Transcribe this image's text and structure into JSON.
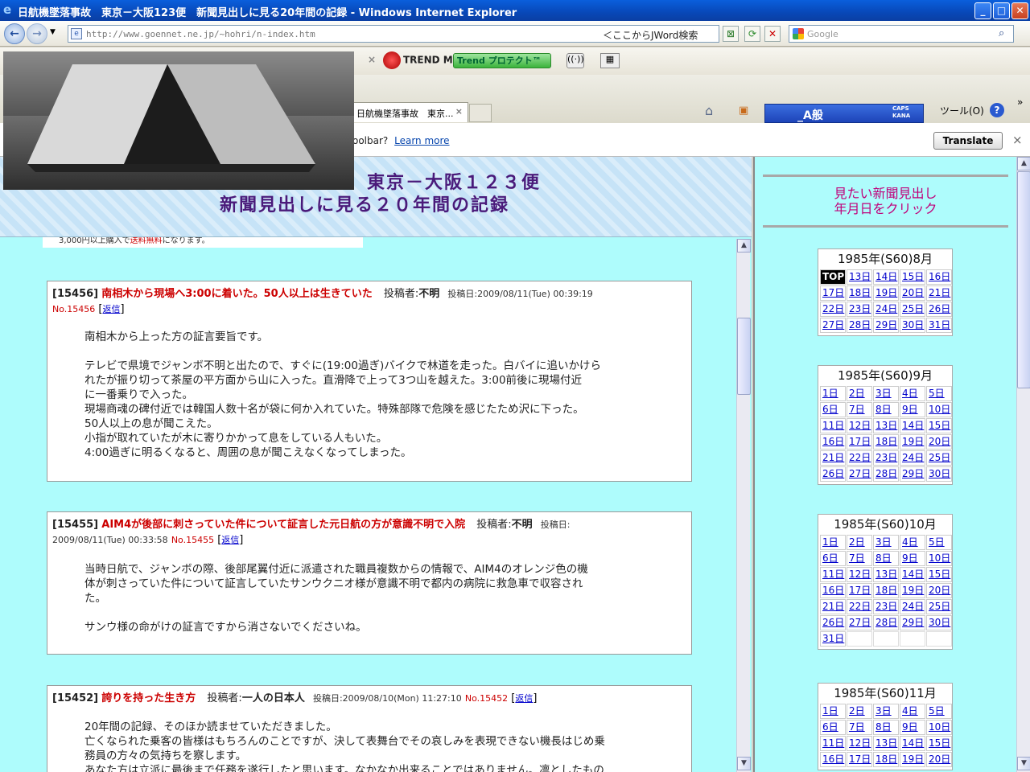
{
  "window": {
    "title": "日航機墜落事故　東京－大阪123便　新聞見出しに見る20年間の記録 - Windows Internet Explorer",
    "minimize_glyph": "_",
    "maximize_glyph": "□",
    "close_glyph": "✕"
  },
  "address_bar": {
    "url": "http://www.goennet.ne.jp/~hohri/n-index.htm",
    "jword_label": "＜ここからJWord検索",
    "search_placeholder": "Google"
  },
  "toolbar": {
    "trend_label": "TREND MICRO",
    "protect_label": "Trend プロテクト™",
    "tools_label": "ツール(O)",
    "caps_label": "CAPS KANA",
    "ime_label": "_A般"
  },
  "tab": {
    "label": "日航機墜落事故　東京...",
    "close": "×"
  },
  "notification": {
    "message": "oolbar?",
    "link": "Learn more",
    "translate_button": "Translate",
    "close": "×"
  },
  "header": {
    "line1": "東京－大阪１２３便",
    "line2": "新聞見出しに見る２０年間の記録"
  },
  "strip": {
    "prefix": "3,000円以上購入で",
    "red": "送料無料",
    "suffix": "になります。"
  },
  "posts": [
    {
      "id": "[15456]",
      "title": "南相木から現場へ3:00に着いた。50人以上は生きていた",
      "author_label": "投稿者:",
      "author": "不明",
      "date": "投稿日:2009/08/11(Tue) 00:39:19",
      "no": "No.15456",
      "reply": "返信",
      "body": [
        "南相木から上った方の証言要旨です。",
        "",
        "テレビで県境でジャンボ不明と出たので、すぐに(19:00過ぎ)バイクで林道を走った。白バイに追いかけら",
        "れたが振り切って茶屋の平方面から山に入った。直滑降で上って3つ山を越えた。3:00前後に現場付近",
        "に一番乗りで入った。",
        "現場商魂の碑付近では韓国人数十名が袋に何か入れていた。特殊部隊で危険を感じたため沢に下った。",
        "50人以上の息が聞こえた。",
        "小指が取れていたが木に寄りかかって息をしている人もいた。",
        "4:00過ぎに明るくなると、周囲の息が聞こえなくなってしまった。"
      ]
    },
    {
      "id": "[15455]",
      "title": "AIM4が後部に刺さっていた件について証言した元日航の方が意識不明で入院",
      "author_label": "投稿者:",
      "author": "不明",
      "date": "投稿日:",
      "date2": "2009/08/11(Tue) 00:33:58",
      "no": "No.15455",
      "reply": "返信",
      "body": [
        "当時日航で、ジャンボの際、後部尾翼付近に派遣された職員複数からの情報で、AIM4のオレンジ色の機",
        "体が刺さっていた件について証言していたサンウクニオ様が意識不明で都内の病院に救急車で収容され",
        "た。",
        "",
        "サンウ様の命がけの証言ですから消さないでくださいね。"
      ]
    },
    {
      "id": "[15452]",
      "title": "誇りを持った生き方",
      "author_label": "投稿者:",
      "author": "一人の日本人",
      "date": "投稿日:2009/08/10(Mon) 11:27:10",
      "no": "No.15452",
      "reply": "返信",
      "body": [
        "20年間の記録、そのほか読ませていただきました。",
        "亡くなられた乗客の皆様はもちろんのことですが、決して表舞台でその哀しみを表現できない機長はじめ乗",
        "務員の方々の気持ちを察します。",
        "あなた方は立派に最後まで任務を遂行したと思います。なかなか出来ることではありません。凛としたもの"
      ]
    }
  ],
  "sidebar": {
    "heading_line1": "見たい新聞見出し",
    "heading_line2": "年月日をクリック",
    "calendars": [
      {
        "month": "1985年(S60)8月",
        "days": [
          "TOP",
          "13日",
          "14日",
          "15日",
          "16日",
          "17日",
          "18日",
          "19日",
          "20日",
          "21日",
          "22日",
          "23日",
          "24日",
          "25日",
          "26日",
          "27日",
          "28日",
          "29日",
          "30日",
          "31日"
        ]
      },
      {
        "month": "1985年(S60)9月",
        "days": [
          "1日",
          "2日",
          "3日",
          "4日",
          "5日",
          "6日",
          "7日",
          "8日",
          "9日",
          "10日",
          "11日",
          "12日",
          "13日",
          "14日",
          "15日",
          "16日",
          "17日",
          "18日",
          "19日",
          "20日",
          "21日",
          "22日",
          "23日",
          "24日",
          "25日",
          "26日",
          "27日",
          "28日",
          "29日",
          "30日"
        ]
      },
      {
        "month": "1985年(S60)10月",
        "days": [
          "1日",
          "2日",
          "3日",
          "4日",
          "5日",
          "6日",
          "7日",
          "8日",
          "9日",
          "10日",
          "11日",
          "12日",
          "13日",
          "14日",
          "15日",
          "16日",
          "17日",
          "18日",
          "19日",
          "20日",
          "21日",
          "22日",
          "23日",
          "24日",
          "25日",
          "26日",
          "27日",
          "28日",
          "29日",
          "30日",
          "31日",
          "",
          "",
          "",
          ""
        ]
      },
      {
        "month": "1985年(S60)11月",
        "days": [
          "1日",
          "2日",
          "3日",
          "4日",
          "5日",
          "6日",
          "7日",
          "8日",
          "9日",
          "10日",
          "11日",
          "12日",
          "13日",
          "14日",
          "15日",
          "16日",
          "17日",
          "18日",
          "19日",
          "20日"
        ]
      }
    ]
  },
  "colors": {
    "page_bg": "#aefcfc",
    "post_title": "#cc0000",
    "sidebar_heading": "#c0007a",
    "header_text": "#4a1a7a"
  }
}
